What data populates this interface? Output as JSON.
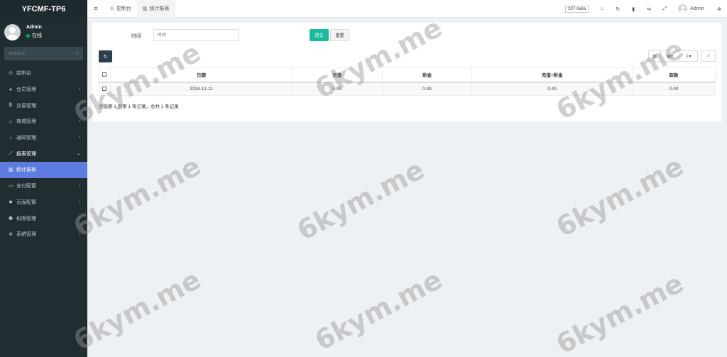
{
  "brand": "YFCMF-TP6",
  "user": {
    "name": "Admin",
    "status": "在线"
  },
  "search": {
    "placeholder": "搜索菜单"
  },
  "menu": [
    {
      "label": "控制台",
      "icon": "dashboard-icon",
      "glyph": "⊙",
      "chevron": ""
    },
    {
      "label": "会员管理",
      "icon": "user-circle-icon",
      "glyph": "●",
      "chevron": "‹"
    },
    {
      "label": "交易管理",
      "icon": "bitcoin-icon",
      "glyph": "₿",
      "chevron": "‹"
    },
    {
      "label": "商城管理",
      "icon": "home-icon",
      "glyph": "⌂",
      "chevron": "‹"
    },
    {
      "label": "通知管理",
      "icon": "bell-icon",
      "glyph": "♪",
      "chevron": "‹"
    },
    {
      "label": "报表管理",
      "icon": "line-chart-icon",
      "glyph": "⟋",
      "chevron": "⌄"
    },
    {
      "label": "统计报表",
      "icon": "bar-chart-icon",
      "glyph": "▥",
      "chevron": ""
    },
    {
      "label": "支付配置",
      "icon": "credit-card-icon",
      "glyph": "▭",
      "chevron": "‹"
    },
    {
      "label": "页面配置",
      "icon": "gear-icon",
      "glyph": "✹",
      "chevron": "‹"
    },
    {
      "label": "权限管理",
      "icon": "users-icon",
      "glyph": "⚉",
      "chevron": "‹"
    },
    {
      "label": "系统管理",
      "icon": "cogs-icon",
      "glyph": "✲",
      "chevron": "‹"
    }
  ],
  "tabs": [
    {
      "label": "控制台",
      "icon": "dashboard-icon",
      "glyph": "⊙"
    },
    {
      "label": "统计报表",
      "icon": "bar-chart-icon",
      "glyph": "▥"
    }
  ],
  "topbar": {
    "region": "207-India",
    "user": "Admin"
  },
  "filter": {
    "label": "时间",
    "placeholder": "时间",
    "submit": "提交",
    "reset": "重置"
  },
  "table": {
    "headers": [
      "日期",
      "充值",
      "彩金",
      "充值+彩金",
      "取款"
    ],
    "rows": [
      [
        "2024-12-11",
        "0.00",
        "0.00",
        "0.00",
        "0.00"
      ]
    ]
  },
  "summary": "显示第 1 到第 1 条记录，总共 1 条记录",
  "watermark": "6kym.me"
}
